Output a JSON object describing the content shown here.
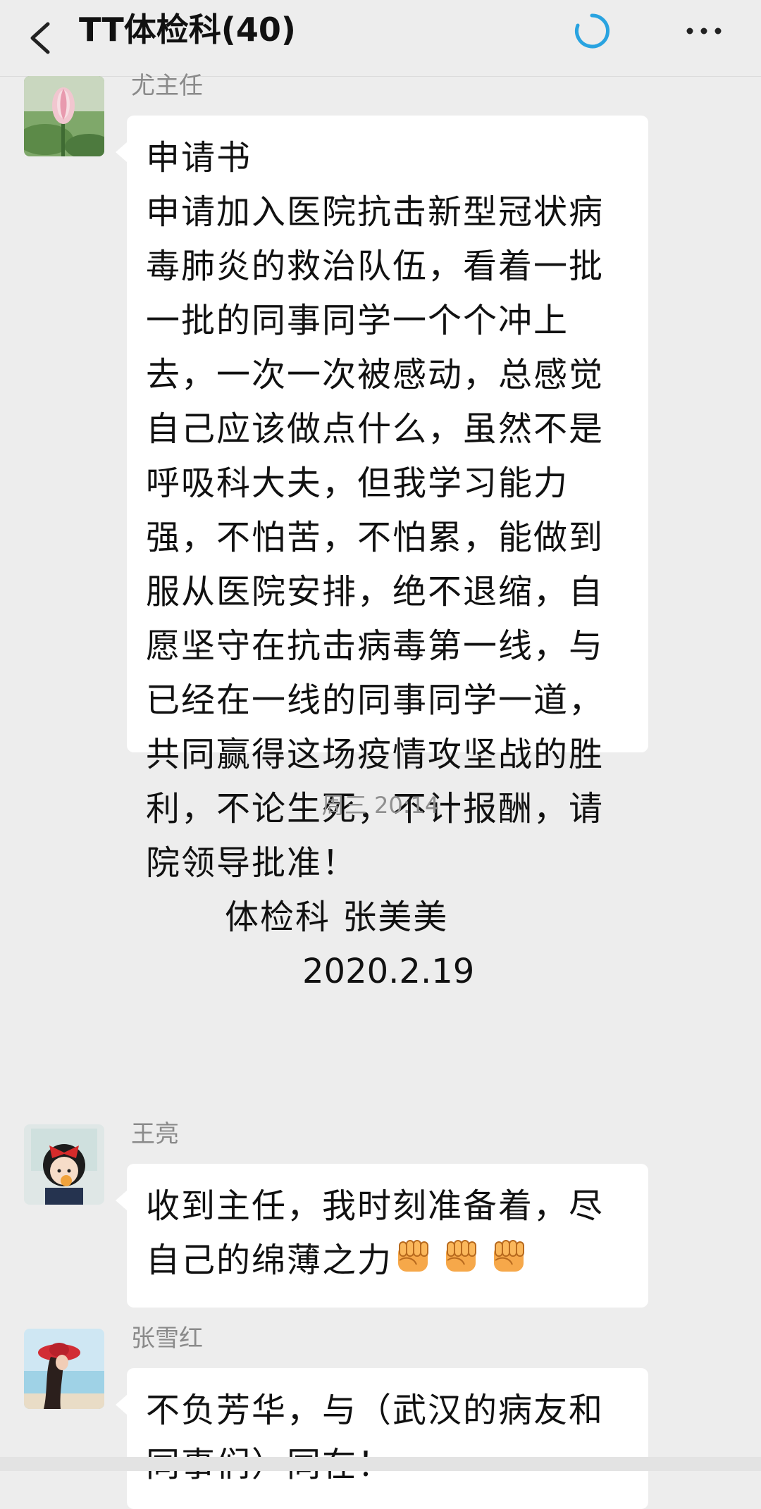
{
  "header": {
    "title": "TT体检科(40)",
    "back_icon": "chevron-left-icon",
    "status_icon": "loading-spinner-icon",
    "more_icon": "more-dots-icon",
    "accent_color": "#29a3e0"
  },
  "messages": [
    {
      "sender": "尤主任",
      "avatar": "lotus-avatar",
      "lines": [
        "申请书",
        "申请加入医院抗击新型冠状病",
        "毒肺炎的救治队伍，看着一批",
        "一批的同事同学一个个冲上",
        "去，一次一次被感动，总感觉",
        "自己应该做点什么，虽然不是",
        "呼吸科大夫，但我学习能力",
        "强，不怕苦，不怕累，能做到",
        "服从医院安排，绝不退缩，自",
        "愿坚守在抗击病毒第一线，与",
        "已经在一线的同事同学一道，",
        "共同赢得这场疫情攻坚战的胜",
        "利，不论生死，不计报酬，请",
        "院领导批准！"
      ],
      "signature": "体检科 张美美",
      "date": "2020.2.19"
    },
    {
      "sender": "王亮",
      "avatar": "cartoon-girl-avatar",
      "lines": [
        "收到主任，我时刻准备着，尽",
        "自己的绵薄之力"
      ],
      "emoji": "fist-emoji"
    },
    {
      "sender": "张雪红",
      "avatar": "beach-hat-avatar",
      "lines": [
        "不负芳华，与（武汉的病友和",
        "同事们）同在！"
      ]
    }
  ],
  "timestamp": "周三 20:14"
}
